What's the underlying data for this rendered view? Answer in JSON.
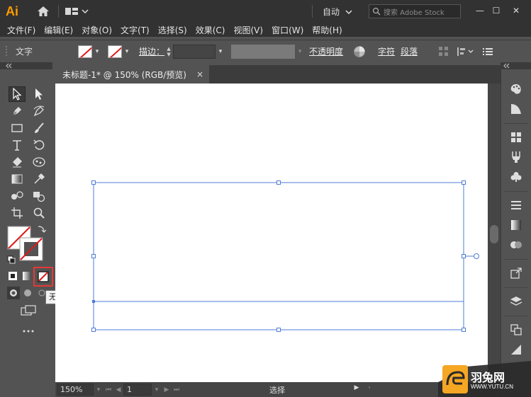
{
  "titlebar": {
    "logo": "Ai",
    "workspace": "自动",
    "search_placeholder": "搜索 Adobe Stock",
    "minimize": "—",
    "maximize": "☐",
    "close": "✕"
  },
  "menu": [
    "文件(F)",
    "编辑(E)",
    "对象(O)",
    "文字(T)",
    "选择(S)",
    "效果(C)",
    "视图(V)",
    "窗口(W)",
    "帮助(H)"
  ],
  "control": {
    "label": "文字",
    "stroke_label": "描边：",
    "opacity_label": "不透明度",
    "char_label": "字符",
    "para_label": "段落"
  },
  "document": {
    "tab_title": "未标题-1* @ 150% (RGB/预览)",
    "close": "×"
  },
  "status": {
    "zoom": "150%",
    "page": "1",
    "mode": "选择"
  },
  "tooltip": "无(/)",
  "watermark": {
    "brand": "羽兔网",
    "url": "WWW.YUTU.CN"
  },
  "colors": {
    "accent_orange": "#ff9a00",
    "selection_blue": "#4f7bd6",
    "highlight_red": "#e53935"
  }
}
